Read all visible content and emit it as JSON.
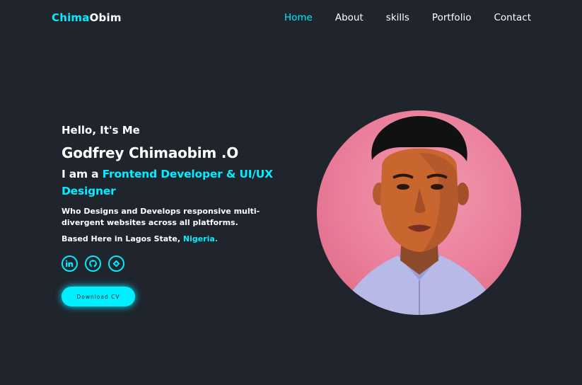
{
  "header": {
    "logo_accent": "Chima",
    "logo_rest": "Obim",
    "nav": [
      {
        "label": "Home",
        "active": true
      },
      {
        "label": "About",
        "active": false
      },
      {
        "label": "skills",
        "active": false
      },
      {
        "label": "Portfolio",
        "active": false
      },
      {
        "label": "Contact",
        "active": false
      }
    ]
  },
  "hero": {
    "greeting": "Hello, It's Me",
    "name": "Godfrey Chimaobim .O",
    "role_prefix": "I am a ",
    "role_highlight": "Frontend Developer & UI/UX Designer",
    "description": "Who Designs and Develops responsive multi-divergent websites across all platforms.",
    "location_prefix": "Based Here in Lagos State, ",
    "location_highlight": "Nigeria.",
    "socials": [
      {
        "icon": "linkedin-icon"
      },
      {
        "icon": "github-icon"
      },
      {
        "icon": "diamond-icon"
      }
    ],
    "cta_label": "Download CV"
  },
  "colors": {
    "background": "#1f242d",
    "accent": "#00eeff",
    "text": "#ffffff"
  }
}
